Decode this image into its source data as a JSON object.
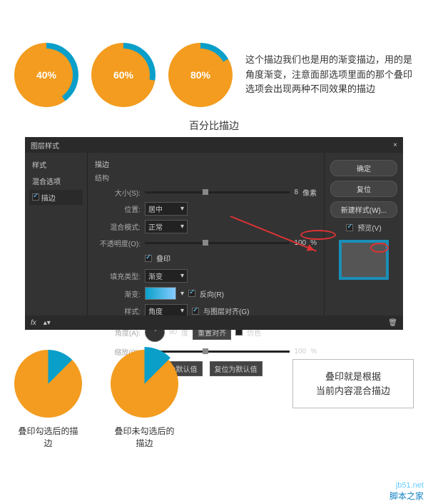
{
  "donuts": {
    "p1": "40%",
    "p2": "60%",
    "p3": "80%"
  },
  "description": "这个描边我们也是用的渐变描边，用的是角度渐变，注意面部选项里面的那个叠印选项会出现两种不同效果的描边",
  "sub_title": "百分比描边",
  "dialog": {
    "title": "图层样式",
    "close": "×",
    "left": {
      "styles": "样式",
      "blend": "混合选项",
      "stroke": "描边"
    },
    "section": "描边",
    "sub": "结构",
    "size_l": "大小(S):",
    "size_v": "8",
    "size_u": "像素",
    "pos_l": "位置:",
    "pos_v": "居中",
    "blend_l": "混合模式:",
    "blend_v": "正常",
    "opac_l": "不透明度(O):",
    "opac_v": "100",
    "opac_u": "%",
    "over_l": "叠印",
    "fill_l": "填充类型:",
    "fill_v": "渐变",
    "grad_l": "渐变:",
    "rev_l": "反向(R)",
    "style_l": "样式:",
    "style_v": "角度",
    "align_l": "与图层对齐(G)",
    "angle_l": "角度(A):",
    "angle_v": "90",
    "angle_u": "度",
    "reset_a": "重置对齐",
    "dither": "仿色",
    "scale_l": "缩放(C):",
    "scale_v": "100",
    "scale_u": "%",
    "def1": "设置为默认值",
    "def2": "复位为默认值",
    "ok": "确定",
    "cancel": "复位",
    "newstyle": "新建样式(W)...",
    "preview": "预览(V)",
    "fx": "fx"
  },
  "bottom": {
    "cap1": "叠印勾选后的描边",
    "cap2": "叠印未勾选后的描边",
    "note": "叠印就是根据\n当前内容混合描边"
  },
  "watermark": {
    "site": "jb51.net",
    "name": "脚本之家"
  }
}
